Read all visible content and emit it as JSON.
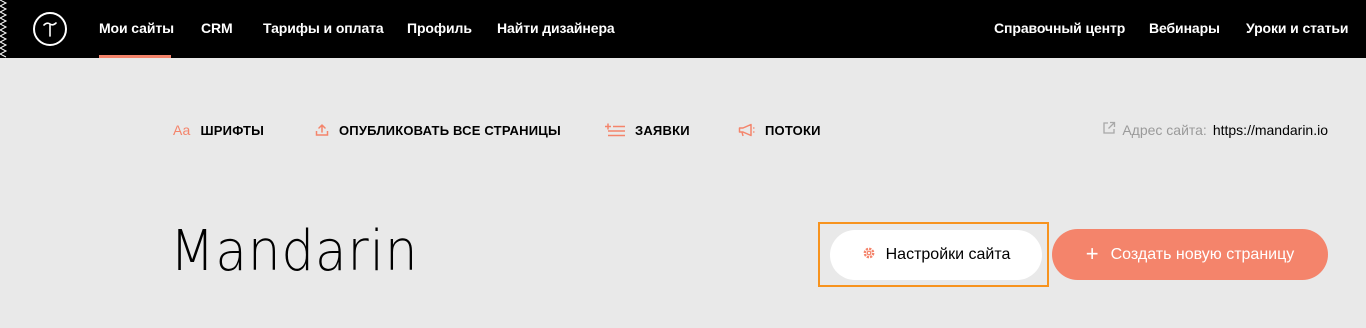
{
  "nav": {
    "items": [
      {
        "label": "Мои сайты"
      },
      {
        "label": "CRM"
      },
      {
        "label": "Тарифы и оплата"
      },
      {
        "label": "Профиль"
      },
      {
        "label": "Найти дизайнера"
      }
    ],
    "right_items": [
      {
        "label": "Справочный центр"
      },
      {
        "label": "Вебинары"
      },
      {
        "label": "Уроки и статьи"
      }
    ],
    "active_index": 0
  },
  "actions": {
    "fonts_icon_text": "Aa",
    "fonts_label": "ШРИФТЫ",
    "publish_label": "ОПУБЛИКОВАТЬ ВСЕ СТРАНИЦЫ",
    "requests_label": "ЗАЯВКИ",
    "streams_label": "ПОТОКИ"
  },
  "site": {
    "address_label": "Адрес сайта:",
    "address_url": "https://mandarin.io",
    "title": "Mandarin",
    "settings_label": "Настройки сайта",
    "create_page_label": "Создать новую страницу"
  },
  "colors": {
    "accent": "#f4846b",
    "highlight_border": "#f7931e",
    "topbar": "#000000",
    "background": "#e9e9e9"
  },
  "icons": {
    "logo": "tilda-logo",
    "fonts": "font-aa-icon",
    "publish": "upload-icon",
    "requests": "list-plus-icon",
    "streams": "megaphone-icon",
    "address": "external-link-icon",
    "settings": "gear-icon",
    "create": "plus-icon"
  }
}
